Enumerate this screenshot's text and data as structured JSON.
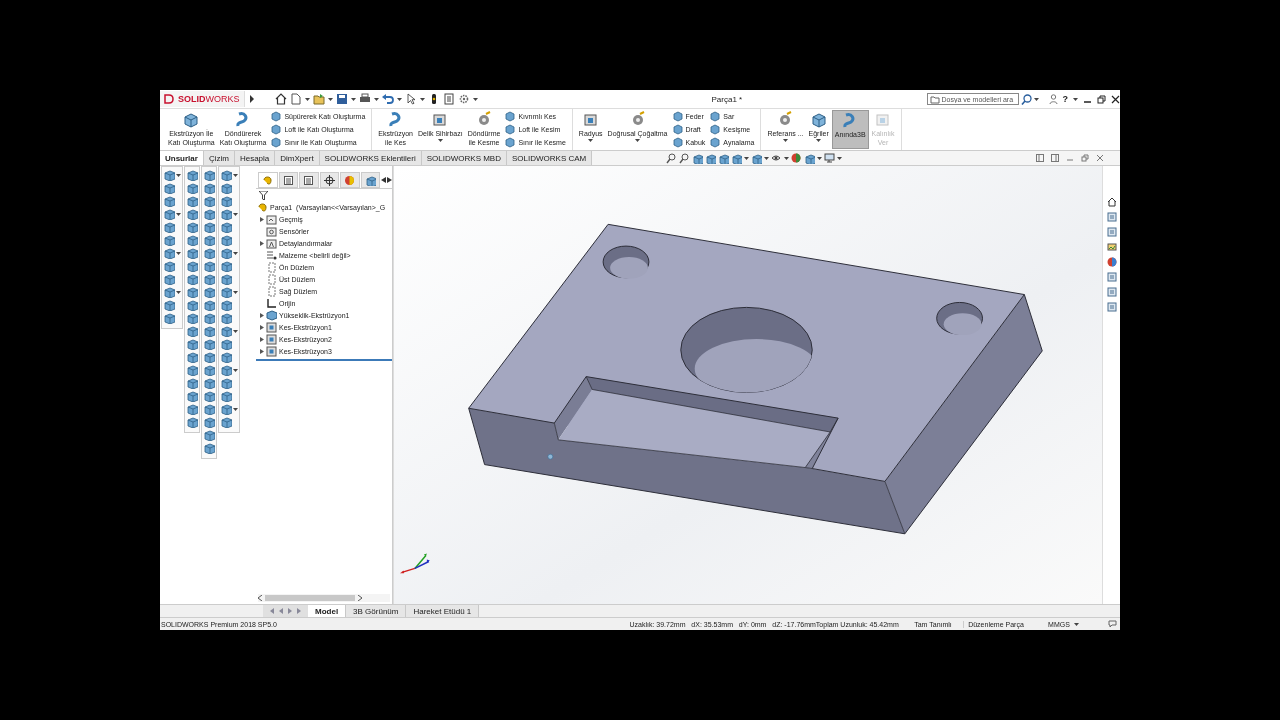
{
  "title_bar": {
    "logo": "**SOLID**WORKS",
    "title": "Parça1 *",
    "search": {
      "placeholder": "Dosya ve modelleri ara"
    },
    "help": "?"
  },
  "ribbon": {
    "groups": [
      {
        "items": [
          {
            "kind": "large",
            "label": "Ekstrüzyon İle\nKatı Oluşturma",
            "dropdown": false,
            "on": false,
            "disabled": false
          },
          {
            "kind": "large",
            "label": "Döndürerek\nKatı Oluşturma",
            "dropdown": false,
            "on": false,
            "disabled": false
          },
          {
            "kind": "stack",
            "labels": [
              "Süpürerek Katı Oluşturma",
              "Loft ile Katı Oluşturma",
              "Sınır ile Katı Oluşturma"
            ]
          }
        ]
      },
      {
        "items": [
          {
            "kind": "large",
            "label": "Ekstrüzyon\nile Kes",
            "dropdown": false,
            "on": false,
            "disabled": false
          },
          {
            "kind": "large",
            "label": "Delik Sihirbazı",
            "dropdown": true,
            "on": false,
            "disabled": false
          },
          {
            "kind": "large",
            "label": "Döndürme\nile Kesme",
            "dropdown": false,
            "on": false,
            "disabled": false
          },
          {
            "kind": "stack",
            "labels": [
              "Kıvrımlı Kes",
              "Loft ile Kesim",
              "Sınır ile Kesme"
            ]
          }
        ]
      },
      {
        "items": [
          {
            "kind": "large",
            "label": "Radyus",
            "dropdown": true,
            "on": false,
            "disabled": false
          },
          {
            "kind": "large",
            "label": "Doğrusal Çoğaltma",
            "dropdown": true,
            "on": false,
            "disabled": false
          },
          {
            "kind": "stack",
            "labels": [
              "Feder",
              "Draft",
              "Kabuk"
            ]
          },
          {
            "kind": "stack",
            "labels": [
              "Sar",
              "Kesişme",
              "Aynalama"
            ]
          }
        ]
      },
      {
        "items": [
          {
            "kind": "large",
            "label": "Referans ...",
            "dropdown": true,
            "on": false,
            "disabled": false
          },
          {
            "kind": "large",
            "label": "Eğriler",
            "dropdown": true,
            "on": false,
            "disabled": false
          },
          {
            "kind": "large",
            "label": "Anında3B",
            "dropdown": false,
            "on": true,
            "disabled": false
          },
          {
            "kind": "large",
            "label": "Kalınlık\nVer",
            "dropdown": false,
            "on": false,
            "disabled": true
          }
        ]
      }
    ]
  },
  "tabs": [
    {
      "label": "Unsurlar",
      "selected": true
    },
    {
      "label": "Çizim",
      "selected": false
    },
    {
      "label": "Hesapla",
      "selected": false
    },
    {
      "label": "DimXpert",
      "selected": false
    },
    {
      "label": "SOLIDWORKS Eklentileri",
      "selected": false
    },
    {
      "label": "SOLIDWORKS MBD",
      "selected": false
    },
    {
      "label": "SOLIDWORKS CAM",
      "selected": false
    }
  ],
  "feature_tree": {
    "root": {
      "label": "Parça1  (Varsayılan<<Varsayılan>_G",
      "kind": "part",
      "children": [
        {
          "label": "Geçmiş",
          "kind": "history",
          "expandable": true
        },
        {
          "label": "Sensörler",
          "kind": "sensor",
          "expandable": false
        },
        {
          "label": "Detaylandırmalar",
          "kind": "annotation",
          "expandable": true
        },
        {
          "label": "Malzeme <belirli değil>",
          "kind": "material",
          "expandable": false
        },
        {
          "label": "Ön Düzlem",
          "kind": "plane",
          "expandable": false
        },
        {
          "label": "Üst Düzlem",
          "kind": "plane",
          "expandable": false
        },
        {
          "label": "Sağ Düzlem",
          "kind": "plane",
          "expandable": false
        },
        {
          "label": "Orijin",
          "kind": "origin",
          "expandable": false
        },
        {
          "label": "Yükseklik-Ekstrüzyon1",
          "kind": "boss",
          "expandable": true
        },
        {
          "label": "Kes-Ekstrüzyon1",
          "kind": "cut",
          "expandable": true
        },
        {
          "label": "Kes-Ekstrüzyon2",
          "kind": "cut",
          "expandable": true
        },
        {
          "label": "Kes-Ekstrüzyon3",
          "kind": "cut",
          "expandable": true
        }
      ]
    }
  },
  "bottom_tabs": [
    {
      "label": "Model",
      "selected": true
    },
    {
      "label": "3B Görünüm",
      "selected": false
    },
    {
      "label": "Hareket Etüdü 1",
      "selected": false
    }
  ],
  "status_bar": {
    "version": "SOLIDWORKS Premium 2018 SP5.0",
    "measurement": "Uzaklık: 39.72mm   dX: 35.53mm   dY: 0mm   dZ: -17.76mmToplam Uzunluk: 45.42mm",
    "definition": "Tam Tanımlı",
    "mode": "Düzenleme Parça",
    "units": "MMGS"
  }
}
